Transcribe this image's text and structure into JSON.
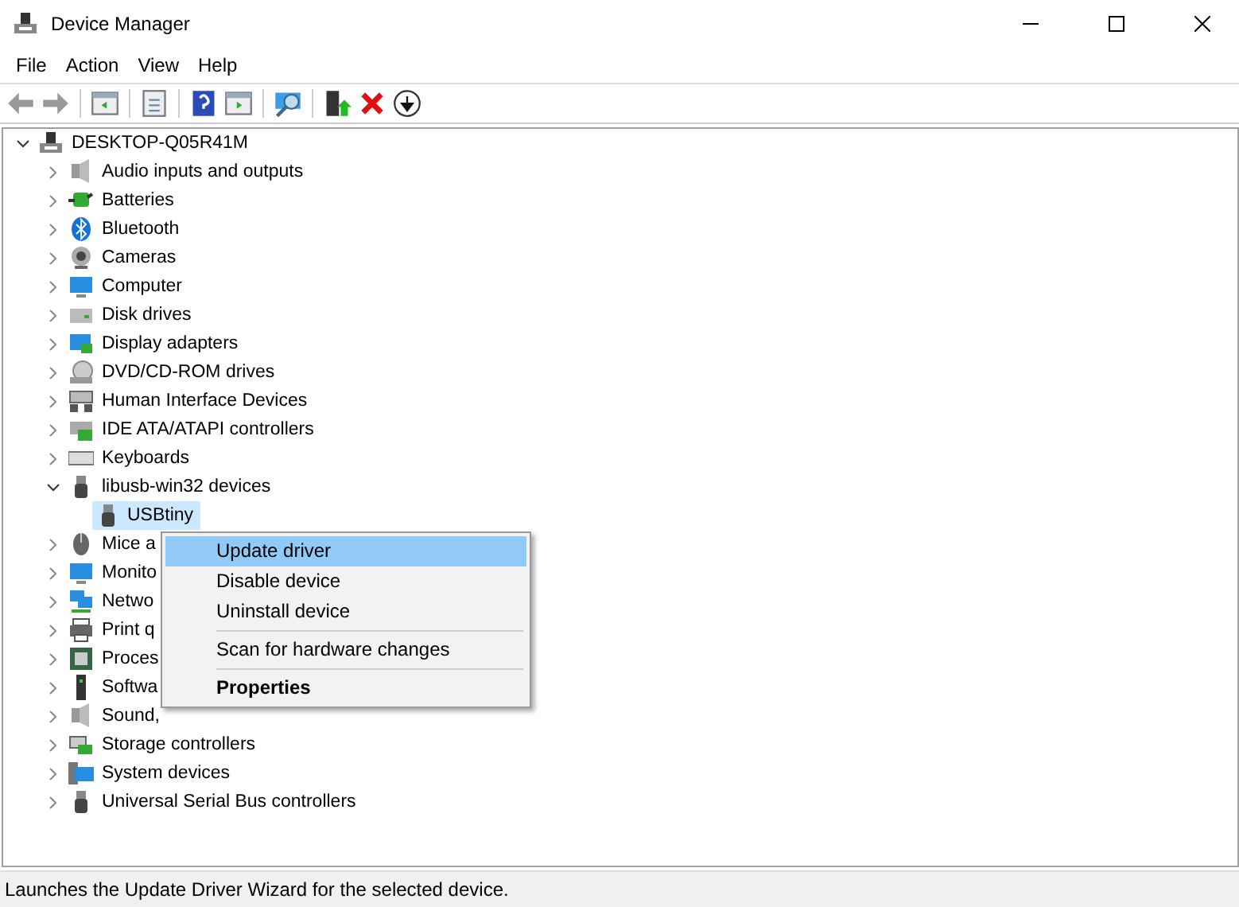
{
  "window": {
    "title": "Device Manager"
  },
  "menu_bar": [
    "File",
    "Action",
    "View",
    "Help"
  ],
  "tree": {
    "label": "DESKTOP-Q05R41M",
    "expanded": true,
    "children": [
      {
        "label": "Audio inputs and outputs",
        "expanded": false
      },
      {
        "label": "Batteries",
        "expanded": false
      },
      {
        "label": "Bluetooth",
        "expanded": false
      },
      {
        "label": "Cameras",
        "expanded": false
      },
      {
        "label": "Computer",
        "expanded": false
      },
      {
        "label": "Disk drives",
        "expanded": false
      },
      {
        "label": "Display adapters",
        "expanded": false
      },
      {
        "label": "DVD/CD-ROM drives",
        "expanded": false
      },
      {
        "label": "Human Interface Devices",
        "expanded": false
      },
      {
        "label": "IDE ATA/ATAPI controllers",
        "expanded": false
      },
      {
        "label": "Keyboards",
        "expanded": false
      },
      {
        "label": "libusb-win32 devices",
        "expanded": true,
        "children": [
          {
            "label": "USBtiny",
            "selected": true
          }
        ]
      },
      {
        "label": "Mice a",
        "expanded": false
      },
      {
        "label": "Monito",
        "expanded": false
      },
      {
        "label": "Netwo",
        "expanded": false
      },
      {
        "label": "Print q",
        "expanded": false
      },
      {
        "label": "Proces",
        "expanded": false
      },
      {
        "label": "Softwa",
        "expanded": false
      },
      {
        "label": "Sound,",
        "expanded": false
      },
      {
        "label": "Storage controllers",
        "expanded": false
      },
      {
        "label": "System devices",
        "expanded": false
      },
      {
        "label": "Universal Serial Bus controllers",
        "expanded": false
      }
    ]
  },
  "context_menu": [
    {
      "label": "Update driver",
      "selected": true,
      "kind": "item"
    },
    {
      "label": "Disable device",
      "selected": false,
      "kind": "item"
    },
    {
      "label": "Uninstall device",
      "selected": false,
      "kind": "item"
    },
    {
      "kind": "separator"
    },
    {
      "label": "Scan for hardware changes",
      "selected": false,
      "kind": "item"
    },
    {
      "kind": "separator"
    },
    {
      "label": "Properties",
      "selected": false,
      "kind": "default"
    }
  ],
  "status_bar": "Launches the Update Driver Wizard for the selected device."
}
